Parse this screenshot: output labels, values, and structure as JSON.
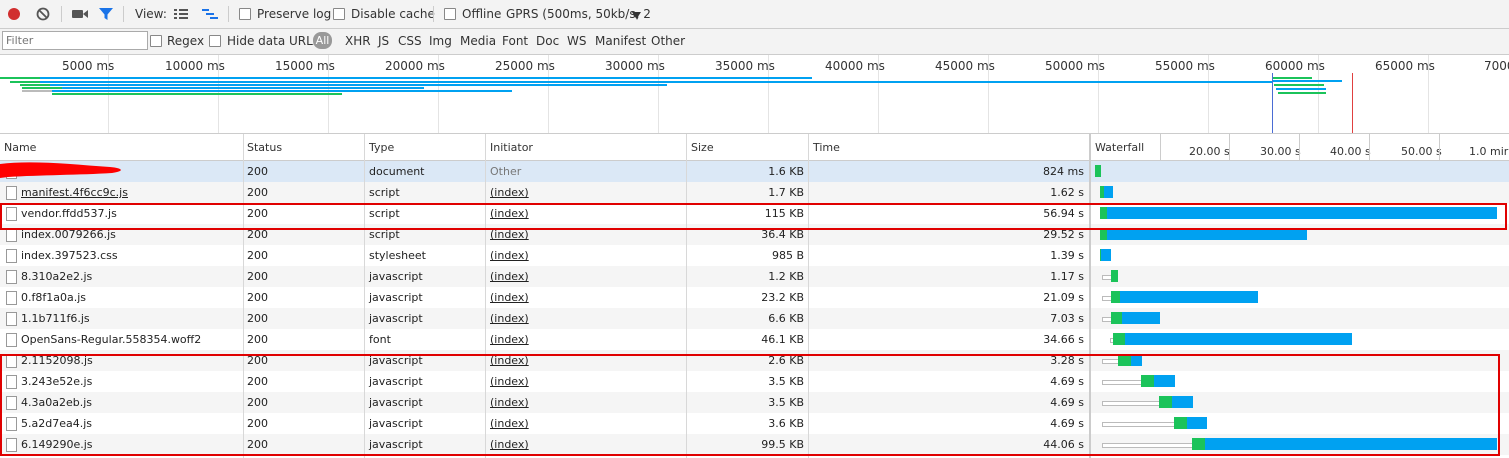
{
  "toolbar": {
    "view_label": "View:",
    "preserve_log_label": "Preserve log",
    "disable_cache_label": "Disable cache",
    "offline_label": "Offline",
    "throttle_value": "GPRS (500ms, 50kb/s, 2",
    "colors": {
      "record": "#d12f2f",
      "filter_icon": "#1a73e8"
    }
  },
  "filterbar": {
    "placeholder": "Filter",
    "regex_label": "Regex",
    "hide_data_urls_label": "Hide data URLs",
    "types": [
      "All",
      "XHR",
      "JS",
      "CSS",
      "Img",
      "Media",
      "Font",
      "Doc",
      "WS",
      "Manifest",
      "Other"
    ]
  },
  "overview": {
    "ticks": [
      "5000 ms",
      "10000 ms",
      "15000 ms",
      "20000 ms",
      "25000 ms",
      "30000 ms",
      "35000 ms",
      "40000 ms",
      "45000 ms",
      "50000 ms",
      "55000 ms",
      "60000 ms",
      "65000 ms",
      "7000"
    ]
  },
  "table": {
    "headers": {
      "name": "Name",
      "status": "Status",
      "type": "Type",
      "initiator": "Initiator",
      "size": "Size",
      "time": "Time",
      "waterfall": "Waterfall"
    },
    "waterfall_ticks": [
      "20.00 s",
      "30.00 s",
      "40.00 s",
      "50.00 s",
      "1.0 mir"
    ],
    "rows": [
      {
        "name": "",
        "status": "200",
        "type": "document",
        "initiator": "Other",
        "size": "1.6 KB",
        "time": "824 ms"
      },
      {
        "name": "manifest.4f6cc9c.js",
        "status": "200",
        "type": "script",
        "initiator": "(index)",
        "size": "1.7 KB",
        "time": "1.62 s"
      },
      {
        "name": "vendor.ffdd537.js",
        "status": "200",
        "type": "script",
        "initiator": "(index)",
        "size": "115 KB",
        "time": "56.94 s"
      },
      {
        "name": "index.0079266.js",
        "status": "200",
        "type": "script",
        "initiator": "(index)",
        "size": "36.4 KB",
        "time": "29.52 s"
      },
      {
        "name": "index.397523.css",
        "status": "200",
        "type": "stylesheet",
        "initiator": "(index)",
        "size": "985 B",
        "time": "1.39 s"
      },
      {
        "name": "8.310a2e2.js",
        "status": "200",
        "type": "javascript",
        "initiator": "(index)",
        "size": "1.2 KB",
        "time": "1.17 s"
      },
      {
        "name": "0.f8f1a0a.js",
        "status": "200",
        "type": "javascript",
        "initiator": "(index)",
        "size": "23.2 KB",
        "time": "21.09 s"
      },
      {
        "name": "1.1b711f6.js",
        "status": "200",
        "type": "javascript",
        "initiator": "(index)",
        "size": "6.6 KB",
        "time": "7.03 s"
      },
      {
        "name": "OpenSans-Regular.558354.woff2",
        "status": "200",
        "type": "font",
        "initiator": "(index)",
        "size": "46.1 KB",
        "time": "34.66 s"
      },
      {
        "name": "2.1152098.js",
        "status": "200",
        "type": "javascript",
        "initiator": "(index)",
        "size": "2.6 KB",
        "time": "3.28 s"
      },
      {
        "name": "3.243e52e.js",
        "status": "200",
        "type": "javascript",
        "initiator": "(index)",
        "size": "3.5 KB",
        "time": "4.69 s"
      },
      {
        "name": "4.3a0a2eb.js",
        "status": "200",
        "type": "javascript",
        "initiator": "(index)",
        "size": "3.5 KB",
        "time": "4.69 s"
      },
      {
        "name": "5.a2d7ea4.js",
        "status": "200",
        "type": "javascript",
        "initiator": "(index)",
        "size": "3.6 KB",
        "time": "4.69 s"
      },
      {
        "name": "6.149290e.js",
        "status": "200",
        "type": "javascript",
        "initiator": "(index)",
        "size": "99.5 KB",
        "time": "44.06 s"
      }
    ]
  },
  "colors": {
    "waterfall_waiting": "#1bc35a",
    "waterfall_download": "#00a1f1",
    "annotation_red": "#e00000",
    "selected_row": "#dbe8f6"
  }
}
